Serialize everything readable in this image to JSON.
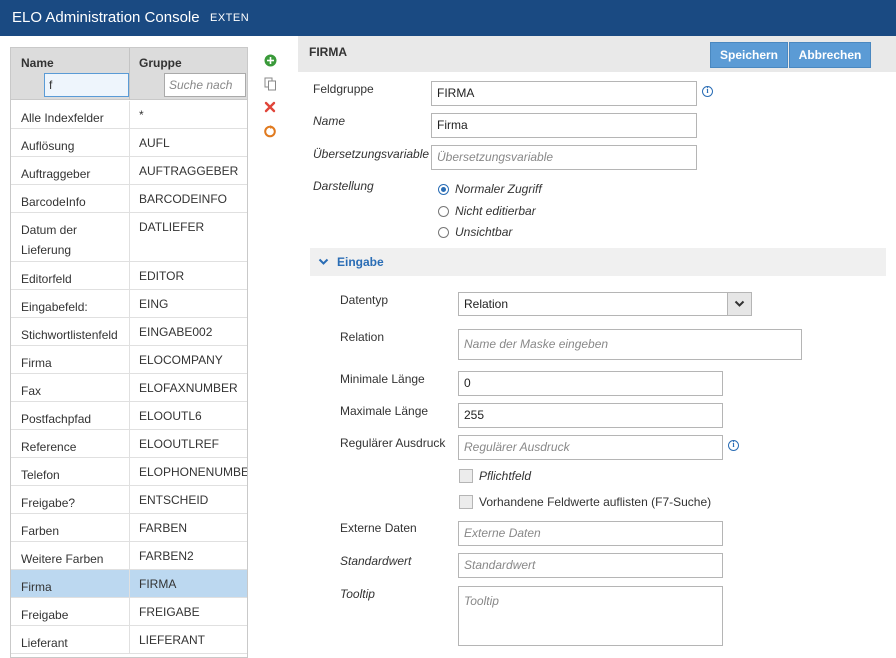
{
  "app": {
    "title": "ELO Administration Console",
    "subtitle": "EXTEN"
  },
  "list": {
    "headers": {
      "name": "Name",
      "group": "Gruppe"
    },
    "filters": {
      "name_value": "f",
      "group_placeholder": "Suche nach"
    },
    "rows": [
      {
        "name": "Alle Indexfelder",
        "group": "*"
      },
      {
        "name": "Auflösung",
        "group": "AUFL"
      },
      {
        "name": "Auftraggeber",
        "group": "AUFTRAGGEBER"
      },
      {
        "name": "BarcodeInfo",
        "group": "BARCODEINFO"
      },
      {
        "name": "Datum der Lieferung",
        "group": "DATLIEFER"
      },
      {
        "name": "Editorfeld",
        "group": "EDITOR"
      },
      {
        "name": "Eingabefeld:",
        "group": "EING"
      },
      {
        "name": "Stichwortlistenfeld",
        "group": "EINGABE002"
      },
      {
        "name": "Firma",
        "group": "ELOCOMPANY"
      },
      {
        "name": "Fax",
        "group": "ELOFAXNUMBER"
      },
      {
        "name": "Postfachpfad",
        "group": "ELOOUTL6"
      },
      {
        "name": "Reference",
        "group": "ELOOUTLREF"
      },
      {
        "name": "Telefon",
        "group": "ELOPHONENUMBER"
      },
      {
        "name": "Freigabe?",
        "group": "ENTSCHEID"
      },
      {
        "name": "Farben",
        "group": "FARBEN"
      },
      {
        "name": "Weitere Farben",
        "group": "FARBEN2"
      },
      {
        "name": "Firma",
        "group": "FIRMA"
      },
      {
        "name": "Freigabe",
        "group": "FREIGABE"
      },
      {
        "name": "Lieferant",
        "group": "LIEFERANT"
      }
    ],
    "selected_index": 16
  },
  "toolbar": {
    "icons": [
      "add-icon",
      "copy-icon",
      "delete-icon",
      "refresh-icon"
    ]
  },
  "form": {
    "title": "FIRMA",
    "save_label": "Speichern",
    "cancel_label": "Abbrechen",
    "feldgruppe_label": "Feldgruppe",
    "feldgruppe_value": "FIRMA",
    "name_label": "Name",
    "name_value": "Firma",
    "translation_label": "Übersetzungsvariable",
    "translation_placeholder": "Übersetzungsvariable",
    "display_label": "Darstellung",
    "display_options": [
      "Normaler Zugriff",
      "Nicht editierbar",
      "Unsichtbar"
    ],
    "display_selected": "Normaler Zugriff"
  },
  "eingabe": {
    "section_title": "Eingabe",
    "datatype_label": "Datentyp",
    "datatype_value": "Relation",
    "relation_label": "Relation",
    "relation_placeholder": "Name der Maske eingeben",
    "minlen_label": "Minimale Länge",
    "minlen_value": "0",
    "maxlen_label": "Maximale Länge",
    "maxlen_value": "255",
    "regex_label": "Regulärer Ausdruck",
    "regex_placeholder": "Regulärer Ausdruck",
    "required_label": "Pflichtfeld",
    "list_existing_label": "Vorhandene Feldwerte auflisten (F7-Suche)",
    "external_label": "Externe Daten",
    "external_placeholder": "Externe Daten",
    "default_label": "Standardwert",
    "default_placeholder": "Standardwert",
    "tooltip_label": "Tooltip",
    "tooltip_placeholder": "Tooltip"
  },
  "colors": {
    "brand": "#1a4a82",
    "accent": "#5b9bd5",
    "selection": "#bcd8f0",
    "link": "#2a6db5"
  }
}
